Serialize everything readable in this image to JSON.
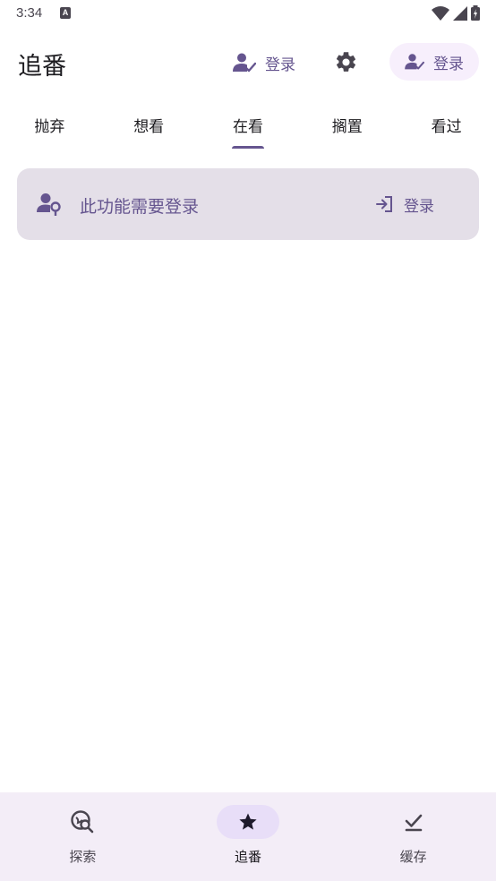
{
  "status_bar": {
    "time": "3:34",
    "notification_letter": "A"
  },
  "app_bar": {
    "title": "追番",
    "login_text_button": "登录",
    "login_tonal_button": "登录"
  },
  "tabs": [
    {
      "label": "抛弃",
      "active": false
    },
    {
      "label": "想看",
      "active": false
    },
    {
      "label": "在看",
      "active": true
    },
    {
      "label": "搁置",
      "active": false
    },
    {
      "label": "看过",
      "active": false
    }
  ],
  "banner": {
    "message": "此功能需要登录",
    "action_label": "登录"
  },
  "bottom_nav": [
    {
      "label": "探索",
      "icon": "explore-search-icon",
      "active": false
    },
    {
      "label": "追番",
      "icon": "star-icon",
      "active": true
    },
    {
      "label": "缓存",
      "icon": "download-done-icon",
      "active": false
    }
  ],
  "colors": {
    "primary": "#65558f",
    "banner_bg": "#e4dfe8",
    "tonal_bg": "#f7effc",
    "nav_bg": "#f3edf7",
    "nav_active_pill": "#e8def8"
  }
}
